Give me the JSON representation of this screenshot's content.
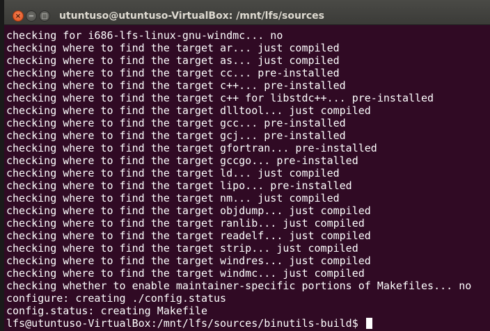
{
  "window": {
    "title": "utuntuso@utuntuso-VirtualBox: /mnt/lfs/sources",
    "close_glyph": "×",
    "minimize_glyph": "−",
    "maximize_glyph": "□"
  },
  "terminal": {
    "lines": [
      "checking for i686-lfs-linux-gnu-windmc... no",
      "checking where to find the target ar... just compiled",
      "checking where to find the target as... just compiled",
      "checking where to find the target cc... pre-installed",
      "checking where to find the target c++... pre-installed",
      "checking where to find the target c++ for libstdc++... pre-installed",
      "checking where to find the target dlltool... just compiled",
      "checking where to find the target gcc... pre-installed",
      "checking where to find the target gcj... pre-installed",
      "checking where to find the target gfortran... pre-installed",
      "checking where to find the target gccgo... pre-installed",
      "checking where to find the target ld... just compiled",
      "checking where to find the target lipo... pre-installed",
      "checking where to find the target nm... just compiled",
      "checking where to find the target objdump... just compiled",
      "checking where to find the target ranlib... just compiled",
      "checking where to find the target readelf... just compiled",
      "checking where to find the target strip... just compiled",
      "checking where to find the target windres... just compiled",
      "checking where to find the target windmc... just compiled",
      "checking whether to enable maintainer-specific portions of Makefiles... no",
      "configure: creating ./config.status",
      "config.status: creating Makefile"
    ],
    "prompt": "lfs@utuntuso-VirtualBox:/mnt/lfs/sources/binutils-build$ "
  },
  "colors": {
    "background": "#300a24",
    "text": "#ffffff",
    "close_button": "#df4b16"
  }
}
